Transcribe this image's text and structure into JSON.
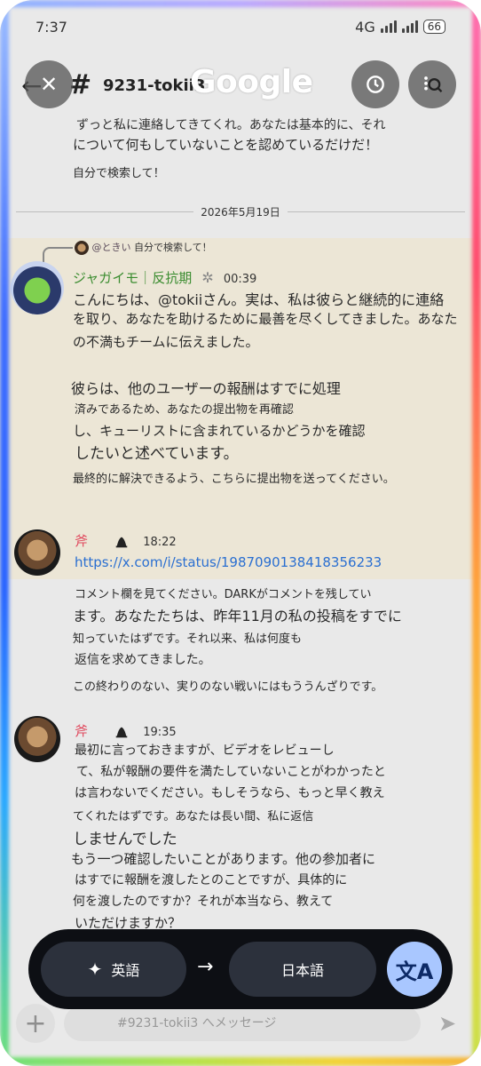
{
  "status_bar": {
    "time": "7:37",
    "network": "4G",
    "battery": "66"
  },
  "header": {
    "channel": "9231-tokii3",
    "channel_suffix": "",
    "google_logo": "Google"
  },
  "messages_top": {
    "line1": "ずっと私に連絡してきてくれ。あなたは基本的に、それ",
    "line2": "について何もしていないことを認めているだけだ！",
    "line3": "自分で検索して！"
  },
  "date_separator": "2026年5月19日",
  "message1": {
    "reply_user": "@ときい",
    "reply_text": "自分で検索して！",
    "username": "ジャガイモ｜反抗期",
    "time": "00:39",
    "lines": [
      "こんにちは、@tokiiさん。実は、私は彼らと継続的に連絡",
      "を取り、あなたを助けるために最善を尽くしてきました。あなた",
      "の不満もチームに伝えました。",
      "彼らは、他のユーザーの報酬はすでに処理",
      "済みであるため、あなたの提出物を再確認",
      "し、キューリストに含まれているかどうかを確認",
      "したいと述べています。",
      "最終的に解決できるよう、こちらに提出物を送ってください。"
    ]
  },
  "message2": {
    "username": "斧",
    "time": "18:22",
    "link": "https://x.com/i/status/1987090138418356233",
    "lines": [
      "コメント欄を見てください。DARKがコメントを残してい",
      "ます。あなたたちは、昨年11月の私の投稿をすでに",
      "知っていたはずです。それ以来、私は何度も",
      "返信を求めてきました。",
      "この終わりのない、実りのない戦いにはもううんざりです。"
    ]
  },
  "message3": {
    "username": "斧",
    "time": "19:35",
    "lines": [
      "最初に言っておきますが、ビデオをレビューし",
      "て、私が報酬の要件を満たしていないことがわかったと",
      "は言わないでください。もしそうなら、もっと早く教え",
      "てくれたはずです。あなたは長い間、私に返信",
      "しませんでした",
      "もう一つ確認したいことがあります。他の参加者に",
      "はすでに報酬を渡したとのことですが、具体的に",
      "何を渡したのですか？それが本当なら、教えて",
      "いただけますか？"
    ]
  },
  "input": {
    "placeholder": "#9231-tokii3 へメッセージ"
  },
  "translate_bar": {
    "source_lang": "英語",
    "target_lang": "日本語",
    "arrow": "→"
  },
  "icons": {
    "close": "close-icon",
    "history": "history-icon",
    "lens": "lens-icon",
    "back": "back-arrow-icon",
    "sparkle": "sparkle-icon",
    "translate": "translate-icon"
  }
}
